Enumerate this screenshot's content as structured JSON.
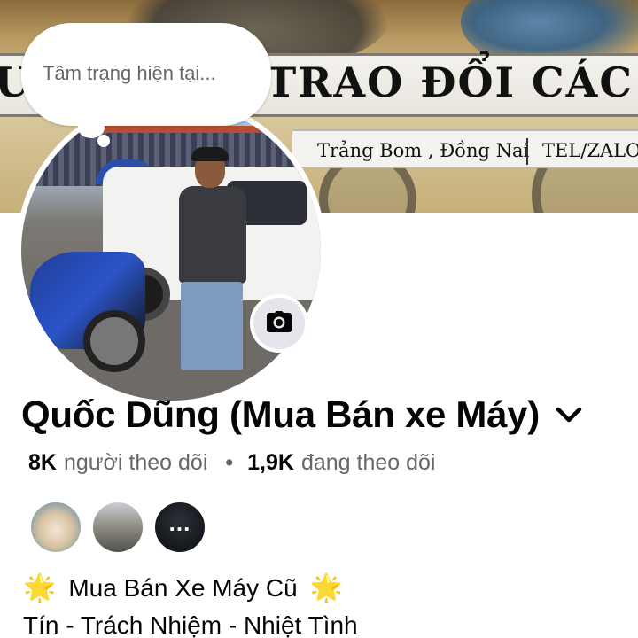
{
  "cover": {
    "banner_left": "U",
    "banner_text": "TRAO ĐỔI CÁC L",
    "location": "Trảng Bom , Đồng Nai",
    "tel": "TEL/ZALO :"
  },
  "status_bubble": {
    "placeholder": "Tâm trạng hiện tại..."
  },
  "profile": {
    "name": "Quốc Dũng (Mua Bán xe Máy)",
    "followers_count": "8K",
    "followers_label": "người theo dõi",
    "separator": "•",
    "following_count": "1,9K",
    "following_label": "đang theo dõi"
  },
  "friends": {
    "more_label": "..."
  },
  "bio": {
    "line1_star": "🌟",
    "line1_text": "Mua Bán Xe Máy Cũ",
    "line2": "Tín - Trách Nhiệm - Nhiệt Tình"
  },
  "icons": {
    "camera": "camera-icon",
    "chevron": "chevron-down-icon"
  },
  "colors": {
    "text_primary": "#050505",
    "text_secondary": "#65676b",
    "button_bg": "#e4e6eb",
    "star": "#f7b928"
  }
}
